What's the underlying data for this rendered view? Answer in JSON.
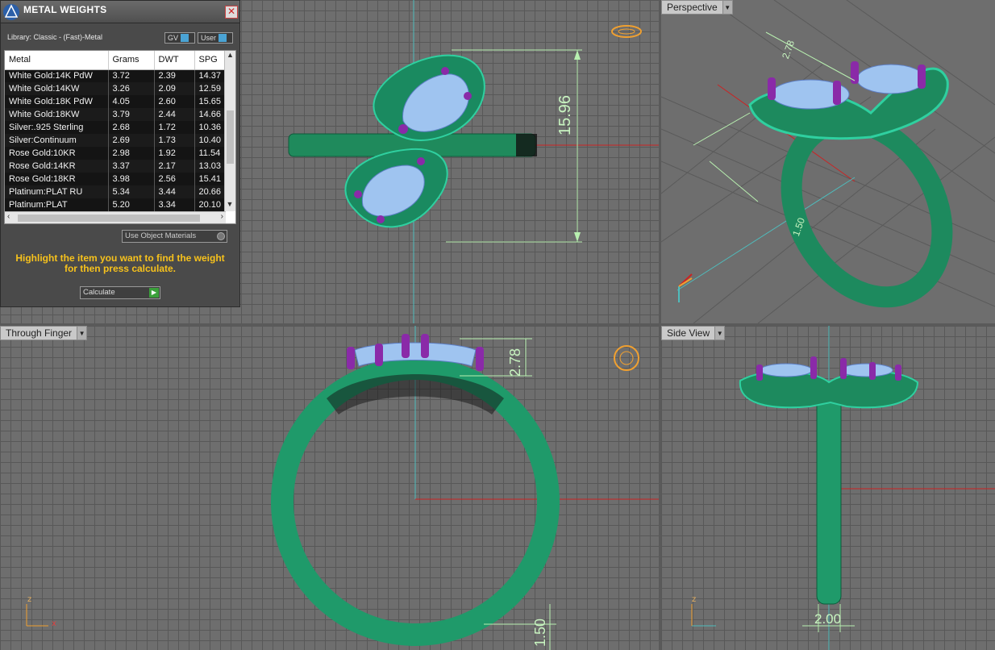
{
  "panel": {
    "title": "METAL WEIGHTS",
    "close": "✕",
    "library": "Library: Classic - (Fast)-Metal",
    "gv_label": "GV",
    "user_label": "User",
    "columns": [
      "Metal",
      "Grams",
      "DWT",
      "SPG"
    ],
    "rows": [
      [
        "White Gold:14K PdW",
        "3.72",
        "2.39",
        "14.37"
      ],
      [
        "White Gold:14KW",
        "3.26",
        "2.09",
        "12.59"
      ],
      [
        "White Gold:18K PdW",
        "4.05",
        "2.60",
        "15.65"
      ],
      [
        "White Gold:18KW",
        "3.79",
        "2.44",
        "14.66"
      ],
      [
        "Silver:.925 Sterling",
        "2.68",
        "1.72",
        "10.36"
      ],
      [
        "Silver:Continuum",
        "2.69",
        "1.73",
        "10.40"
      ],
      [
        "Rose Gold:10KR",
        "2.98",
        "1.92",
        "11.54"
      ],
      [
        "Rose Gold:14KR",
        "3.37",
        "2.17",
        "13.03"
      ],
      [
        "Rose Gold:18KR",
        "3.98",
        "2.56",
        "15.41"
      ],
      [
        "Platinum:PLAT RU",
        "5.34",
        "3.44",
        "20.66"
      ],
      [
        "Platinum:PLAT",
        "5.20",
        "3.34",
        "20.10"
      ]
    ],
    "use_object_materials": "Use Object Materials",
    "hint": "Highlight the item you want to find the weight for then press calculate.",
    "calculate": "Calculate"
  },
  "viewports": {
    "perspective": "Perspective",
    "through_finger": "Through Finger",
    "side_view": "Side View"
  },
  "dimensions": {
    "top_length": "15.96",
    "finger_height": "2.78",
    "finger_bottom": "1.50",
    "side_width": "2.00",
    "persp_a": "2.78",
    "persp_b": "1.50"
  },
  "axes": {
    "x": "x",
    "z": "z"
  },
  "colors": {
    "metal": "#1f9a6a",
    "stone": "#9fc4f0",
    "prong": "#8a2aa8",
    "accent": "#f7c21c"
  }
}
